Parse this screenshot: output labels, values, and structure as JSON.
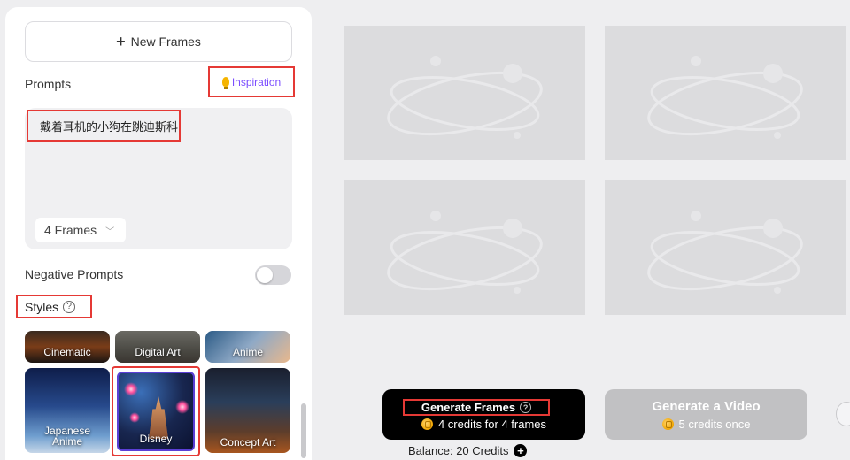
{
  "sidebar": {
    "new_frames_label": "New Frames",
    "prompts_label": "Prompts",
    "inspiration_label": "Inspiration",
    "prompt_text": "戴着耳机的小狗在跳迪斯科",
    "frames_select_value": "4 Frames",
    "negative_prompts_label": "Negative Prompts",
    "negative_prompts_enabled": false,
    "styles_label": "Styles",
    "styles": [
      {
        "label": "Cinematic"
      },
      {
        "label": "Digital Art"
      },
      {
        "label": "Anime"
      },
      {
        "label": "Japanese Anime"
      },
      {
        "label": "Disney",
        "selected": true
      },
      {
        "label": "Concept Art"
      }
    ]
  },
  "actions": {
    "generate_frames_label": "Generate Frames",
    "generate_frames_cost": "4 credits for 4 frames",
    "generate_video_label": "Generate a Video",
    "generate_video_cost": "5 credits once",
    "balance": "Balance: 20 Credits"
  },
  "colors": {
    "highlight": "#e53935",
    "accent": "#7b4dff",
    "selected_border": "#5b3fd6",
    "primary_button": "#000000",
    "disabled_button": "#c1c1c3"
  }
}
